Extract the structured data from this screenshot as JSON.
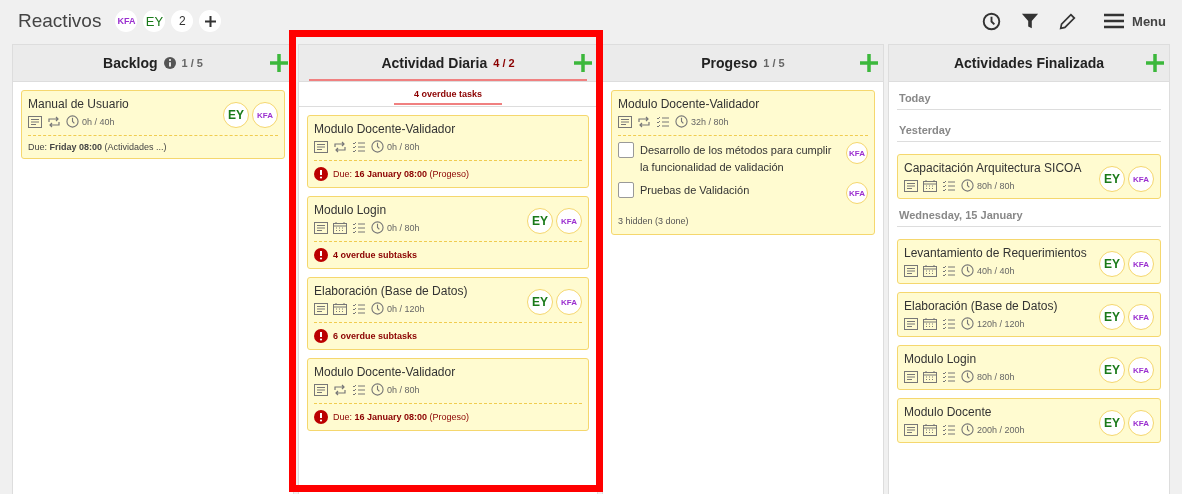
{
  "board": {
    "title": "Reactivos",
    "members": [
      {
        "initials": "KFA",
        "color": "#9b30d0"
      },
      {
        "initials": "EY",
        "color": "#1a7a1a"
      }
    ],
    "more_count": "2",
    "menu_label": "Menu"
  },
  "columns": [
    {
      "title": "Backlog",
      "info": true,
      "count": "1 / 5",
      "over_limit": false,
      "cards": [
        {
          "title": "Manual de Usuario",
          "icons": [
            {
              "kind": "description"
            },
            {
              "kind": "repeat"
            },
            {
              "kind": "clock"
            }
          ],
          "hours": "0h / 40h",
          "avatars": [
            {
              "initials": "EY",
              "color": "#1a7a1a"
            },
            {
              "initials": "KFA",
              "color": "#9b30d0"
            }
          ],
          "footer": {
            "text": "Due: **Friday 08:00** (Actividades ...)",
            "overdue": false
          }
        }
      ]
    },
    {
      "title": "Actividad Diaria",
      "info": false,
      "count": "4 / 2",
      "over_limit": true,
      "banner": "4 overdue tasks",
      "cards": [
        {
          "title": "Modulo Docente-Validador",
          "icons": [
            {
              "kind": "description"
            },
            {
              "kind": "repeat"
            },
            {
              "kind": "checklist"
            },
            {
              "kind": "clock"
            }
          ],
          "hours": "0h / 80h",
          "footer": {
            "text": "Due: **16 January 08:00** (Progeso)",
            "overdue": true
          }
        },
        {
          "title": "Modulo Login",
          "icons": [
            {
              "kind": "description"
            },
            {
              "kind": "calendar"
            },
            {
              "kind": "checklist"
            },
            {
              "kind": "clock"
            }
          ],
          "hours": "0h / 80h",
          "avatars": [
            {
              "initials": "EY",
              "color": "#1a7a1a"
            },
            {
              "initials": "KFA",
              "color": "#9b30d0"
            }
          ],
          "footer": {
            "text": "**4 overdue subtasks**",
            "overdue": true
          }
        },
        {
          "title": "Elaboración (Base de Datos)",
          "icons": [
            {
              "kind": "description"
            },
            {
              "kind": "calendar"
            },
            {
              "kind": "checklist"
            },
            {
              "kind": "clock"
            }
          ],
          "hours": "0h / 120h",
          "avatars": [
            {
              "initials": "EY",
              "color": "#1a7a1a"
            },
            {
              "initials": "KFA",
              "color": "#9b30d0"
            }
          ],
          "footer": {
            "text": "**6 overdue subtasks**",
            "overdue": true
          }
        },
        {
          "title": "Modulo Docente-Validador",
          "icons": [
            {
              "kind": "description"
            },
            {
              "kind": "repeat"
            },
            {
              "kind": "checklist"
            },
            {
              "kind": "clock"
            }
          ],
          "hours": "0h / 80h",
          "footer": {
            "text": "Due: **16 January 08:00** (Progeso)",
            "overdue": true
          }
        }
      ]
    },
    {
      "title": "Progeso",
      "info": false,
      "count": "1 / 5",
      "over_limit": false,
      "cards": [
        {
          "title": "Modulo Docente-Validador",
          "icons": [
            {
              "kind": "description"
            },
            {
              "kind": "repeat"
            },
            {
              "kind": "checklist"
            },
            {
              "kind": "clock"
            }
          ],
          "hours": "32h / 80h",
          "subtasks": [
            {
              "text": "Desarrollo de los métodos para cumplir la funcionalidad de validación",
              "checked": false,
              "avatar": {
                "initials": "KFA",
                "color": "#9b30d0"
              }
            },
            {
              "text": "Pruebas de Validación",
              "checked": false,
              "avatar": {
                "initials": "KFA",
                "color": "#9b30d0"
              }
            }
          ],
          "hidden_note": "3 hidden (3 done)"
        }
      ]
    },
    {
      "title": "Actividades Finalizada",
      "info": false,
      "groups": [
        {
          "heading": "Today"
        },
        {
          "heading": "Yesterday",
          "cards": [
            {
              "title": "Capacitación Arquitectura SICOA",
              "icons": [
                {
                  "kind": "description"
                },
                {
                  "kind": "calendar"
                },
                {
                  "kind": "checklist"
                },
                {
                  "kind": "clock"
                }
              ],
              "hours": "80h / 80h",
              "avatars": [
                {
                  "initials": "EY",
                  "color": "#1a7a1a"
                },
                {
                  "initials": "KFA",
                  "color": "#9b30d0"
                }
              ]
            }
          ]
        },
        {
          "heading": "Wednesday, 15 January",
          "cards": [
            {
              "title": "Levantamiento de Requerimientos",
              "icons": [
                {
                  "kind": "description"
                },
                {
                  "kind": "calendar"
                },
                {
                  "kind": "checklist"
                },
                {
                  "kind": "clock"
                }
              ],
              "hours": "40h / 40h",
              "avatars": [
                {
                  "initials": "EY",
                  "color": "#1a7a1a"
                },
                {
                  "initials": "KFA",
                  "color": "#9b30d0"
                }
              ]
            },
            {
              "title": "Elaboración (Base de Datos)",
              "icons": [
                {
                  "kind": "description"
                },
                {
                  "kind": "calendar"
                },
                {
                  "kind": "checklist"
                },
                {
                  "kind": "clock"
                }
              ],
              "hours": "120h / 120h",
              "avatars": [
                {
                  "initials": "EY",
                  "color": "#1a7a1a"
                },
                {
                  "initials": "KFA",
                  "color": "#9b30d0"
                }
              ]
            },
            {
              "title": "Modulo Login",
              "icons": [
                {
                  "kind": "description"
                },
                {
                  "kind": "calendar"
                },
                {
                  "kind": "checklist"
                },
                {
                  "kind": "clock"
                }
              ],
              "hours": "80h / 80h",
              "avatars": [
                {
                  "initials": "EY",
                  "color": "#1a7a1a"
                },
                {
                  "initials": "KFA",
                  "color": "#9b30d0"
                }
              ]
            },
            {
              "title": "Modulo Docente",
              "icons": [
                {
                  "kind": "description"
                },
                {
                  "kind": "calendar"
                },
                {
                  "kind": "checklist"
                },
                {
                  "kind": "clock"
                }
              ],
              "hours": "200h / 200h",
              "avatars": [
                {
                  "initials": "EY",
                  "color": "#1a7a1a"
                },
                {
                  "initials": "KFA",
                  "color": "#9b30d0"
                }
              ]
            }
          ]
        }
      ]
    }
  ]
}
